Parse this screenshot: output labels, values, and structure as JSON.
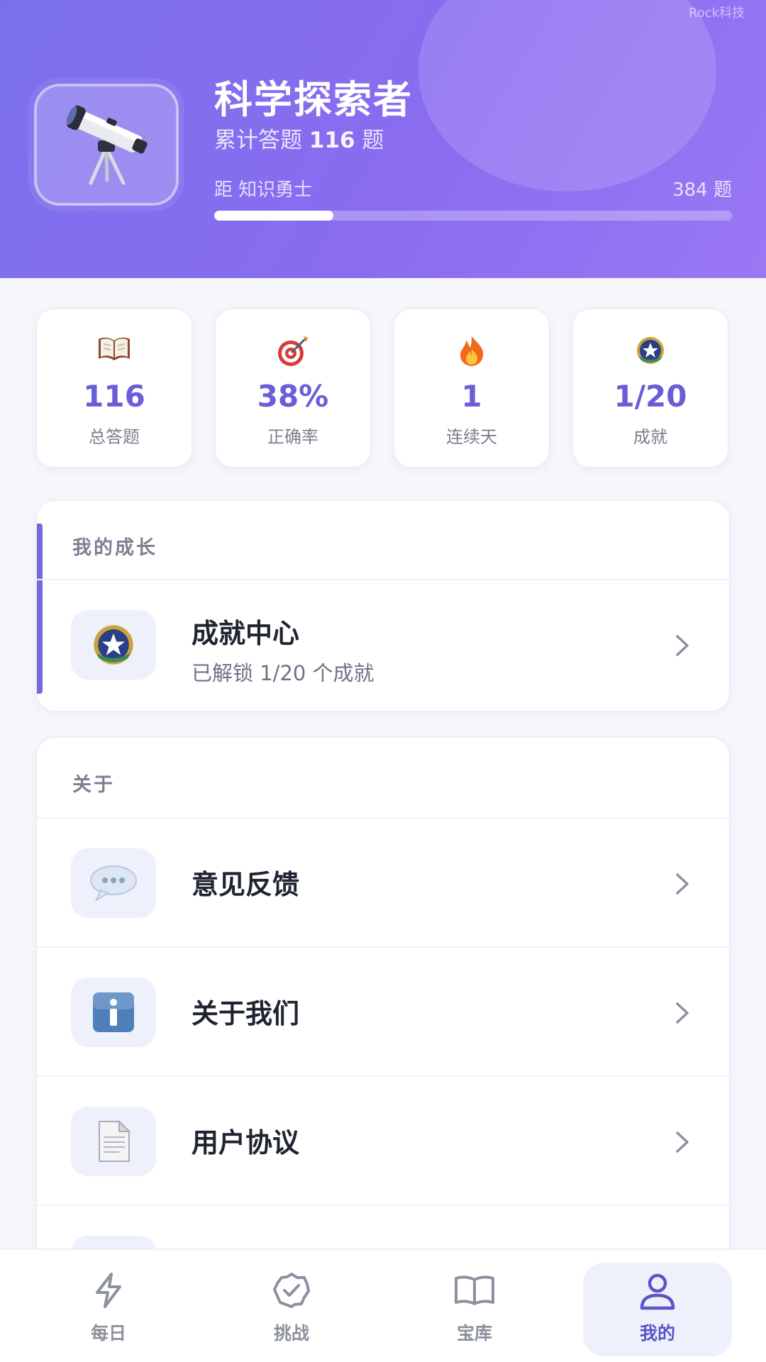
{
  "header": {
    "watermark": "Rock科技",
    "title": "科学探索者",
    "total_prefix": "累计答题 ",
    "total_count": "116",
    "total_suffix": " 题",
    "next_label": "距 知识勇士",
    "remaining": "384 题",
    "progress": 0.23,
    "avatar_icon": "telescope-icon"
  },
  "stats": [
    {
      "icon": "book-icon",
      "value": "116",
      "label": "总答题"
    },
    {
      "icon": "target-icon",
      "value": "38%",
      "label": "正确率"
    },
    {
      "icon": "fire-icon",
      "value": "1",
      "label": "连续天"
    },
    {
      "icon": "badge-icon",
      "value": "1/20",
      "label": "成就"
    }
  ],
  "growth": {
    "title": "我的成长",
    "item": {
      "label": "成就中心",
      "sub": "已解锁 1/20 个成就",
      "icon": "badge-icon"
    }
  },
  "about": {
    "title": "关于",
    "items": [
      {
        "label": "意见反馈",
        "icon": "speech-bubble-icon"
      },
      {
        "label": "关于我们",
        "icon": "info-icon"
      },
      {
        "label": "用户协议",
        "icon": "document-icon"
      }
    ]
  },
  "nav": [
    {
      "label": "每日",
      "icon": "lightning-icon"
    },
    {
      "label": "挑战",
      "icon": "shield-check-icon"
    },
    {
      "label": "宝库",
      "icon": "open-book-icon"
    },
    {
      "label": "我的",
      "icon": "user-icon",
      "active": true
    }
  ],
  "colors": {
    "header_gradient_start": "#7b70ec",
    "header_gradient_end": "#9a78f4",
    "accent": "#6a5ed8",
    "nav_active": "#5a55c8"
  }
}
